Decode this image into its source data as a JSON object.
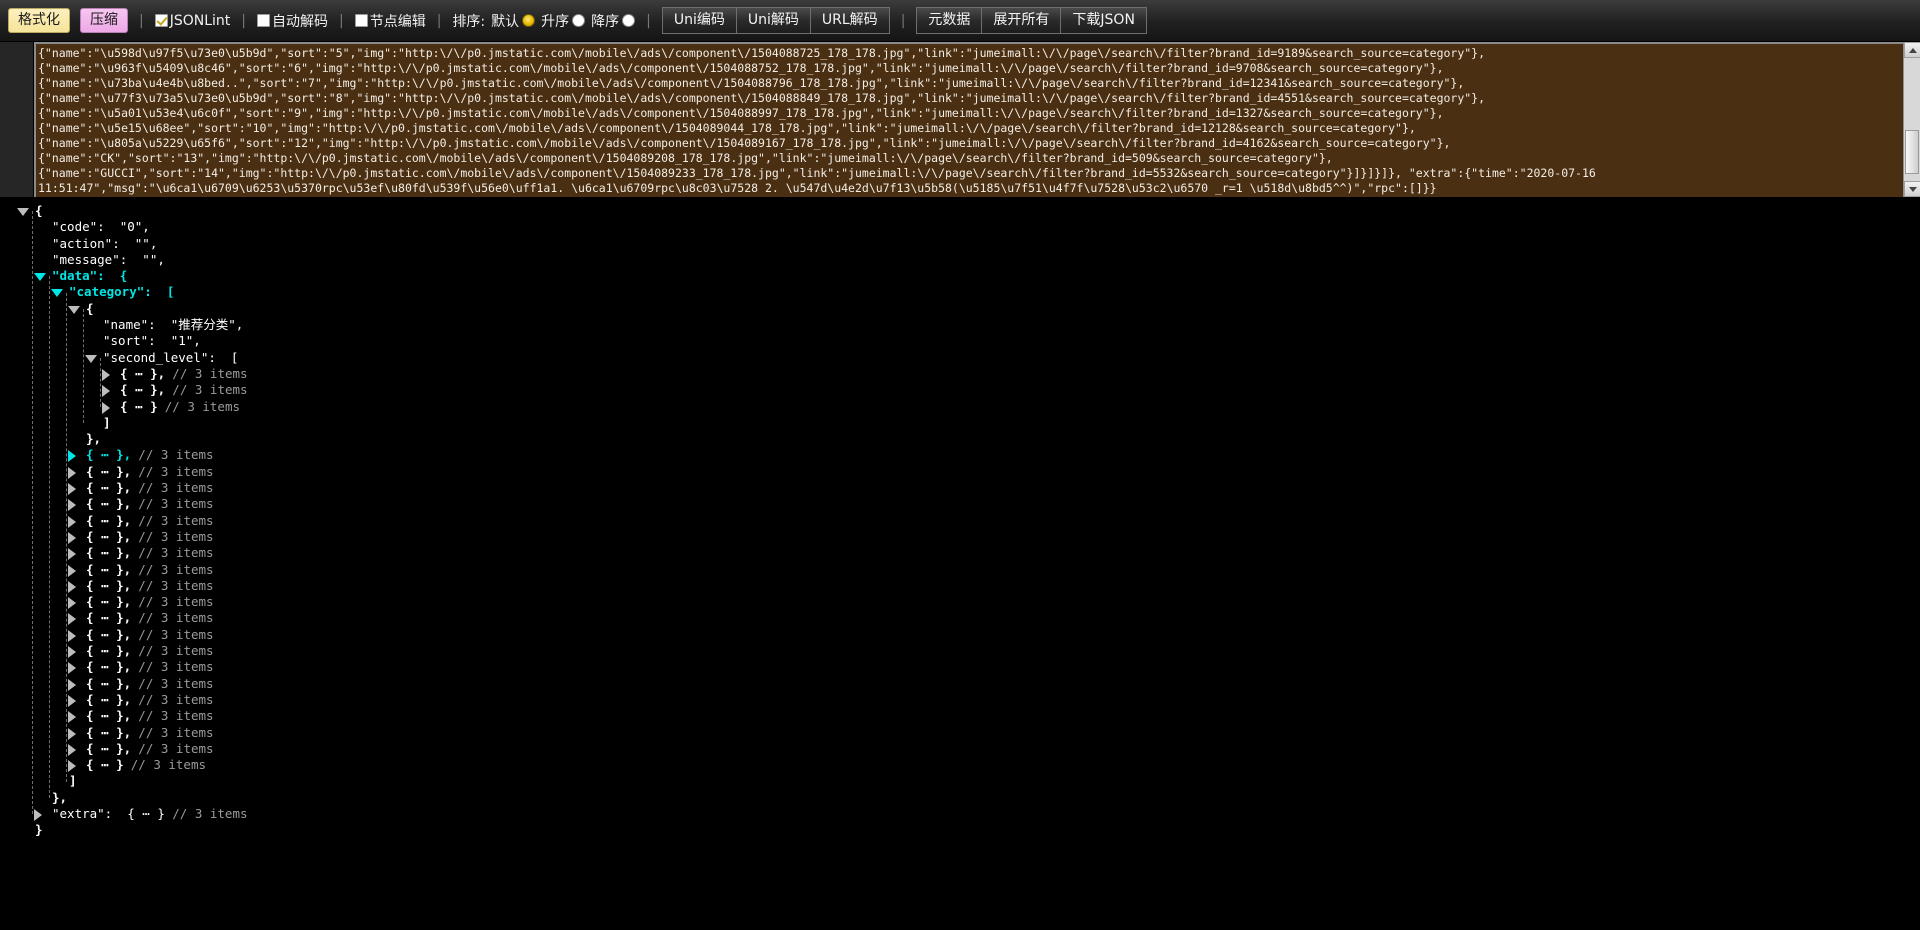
{
  "toolbar": {
    "format_button": "格式化",
    "compress_button": "压缩",
    "separator": "|",
    "jsonlint_label": "JSONLint",
    "jsonlint_checked": true,
    "autodecode_label": "自动解码",
    "autodecode_checked": false,
    "nodeedit_label": "节点编辑",
    "nodeedit_checked": false,
    "sort_label": "排序:",
    "sort_default": "默认",
    "sort_asc": "升序",
    "sort_desc": "降序",
    "sort_selected": "默认",
    "uni_encode": "Uni编码",
    "uni_decode": "Uni解码",
    "url_decode": "URL解码",
    "metadata": "元数据",
    "expand_all": "展开所有",
    "download_json": "下载JSON",
    "accent_yellow": "#f6e49a",
    "accent_pink": "#eda9e6",
    "radio_selected_color": "#e8b800"
  },
  "raw_editor": {
    "background": "#4a2f13",
    "text_color": "#f3ede4",
    "lines": [
      "{\"name\":\"\\u598d\\u97f5\\u73e0\\u5b9d\",\"sort\":\"5\",\"img\":\"http:\\/\\/p0.jmstatic.com\\/mobile\\/ads\\/component\\/1504088725_178_178.jpg\",\"link\":\"jumeimall:\\/\\/page\\/search\\/filter?brand_id=9189&search_source=category\"},",
      "{\"name\":\"\\u963f\\u5409\\u8c46\",\"sort\":\"6\",\"img\":\"http:\\/\\/p0.jmstatic.com\\/mobile\\/ads\\/component\\/1504088752_178_178.jpg\",\"link\":\"jumeimall:\\/\\/page\\/search\\/filter?brand_id=9708&search_source=category\"},",
      "{\"name\":\"\\u73ba\\u4e4b\\u8bed..\",\"sort\":\"7\",\"img\":\"http:\\/\\/p0.jmstatic.com\\/mobile\\/ads\\/component\\/1504088796_178_178.jpg\",\"link\":\"jumeimall:\\/\\/page\\/search\\/filter?brand_id=12341&search_source=category\"},",
      "{\"name\":\"\\u77f3\\u73a5\\u73e0\\u5b9d\",\"sort\":\"8\",\"img\":\"http:\\/\\/p0.jmstatic.com\\/mobile\\/ads\\/component\\/1504088849_178_178.jpg\",\"link\":\"jumeimall:\\/\\/page\\/search\\/filter?brand_id=4551&search_source=category\"},",
      "{\"name\":\"\\u5a01\\u53e4\\u6c0f\",\"sort\":\"9\",\"img\":\"http:\\/\\/p0.jmstatic.com\\/mobile\\/ads\\/component\\/1504088997_178_178.jpg\",\"link\":\"jumeimall:\\/\\/page\\/search\\/filter?brand_id=1327&search_source=category\"},",
      "{\"name\":\"\\u5e15\\u68ee\",\"sort\":\"10\",\"img\":\"http:\\/\\/p0.jmstatic.com\\/mobile\\/ads\\/component\\/1504089044_178_178.jpg\",\"link\":\"jumeimall:\\/\\/page\\/search\\/filter?brand_id=12128&search_source=category\"},",
      "{\"name\":\"\\u805a\\u5229\\u65f6\",\"sort\":\"12\",\"img\":\"http:\\/\\/p0.jmstatic.com\\/mobile\\/ads\\/component\\/1504089167_178_178.jpg\",\"link\":\"jumeimall:\\/\\/page\\/search\\/filter?brand_id=4162&search_source=category\"},",
      "{\"name\":\"CK\",\"sort\":\"13\",\"img\":\"http:\\/\\/p0.jmstatic.com\\/mobile\\/ads\\/component\\/1504089208_178_178.jpg\",\"link\":\"jumeimall:\\/\\/page\\/search\\/filter?brand_id=509&search_source=category\"},",
      "{\"name\":\"GUCCI\",\"sort\":\"14\",\"img\":\"http:\\/\\/p0.jmstatic.com\\/mobile\\/ads\\/component\\/1504089233_178_178.jpg\",\"link\":\"jumeimall:\\/\\/page\\/search\\/filter?brand_id=5532&search_source=category\"}]}]}]}, \"extra\":{\"time\":\"2020-07-16",
      "11:51:47\",\"msg\":\"\\u6ca1\\u6709\\u6253\\u5370rpc\\u53ef\\u80fd\\u539f\\u56e0\\uff1a1. \\u6ca1\\u6709rpc\\u8c03\\u7528 2. \\u547d\\u4e2d\\u7f13\\u5b58(\\u5185\\u7f51\\u4f7f\\u7528\\u53c2\\u6570 _r=1 \\u518d\\u8bd5^^)\",\"rpc\":[]}}"
    ]
  },
  "tree": {
    "rows": [
      {
        "indent": 0,
        "marker": "down-grey",
        "text": "{",
        "style": "ph"
      },
      {
        "indent": 1,
        "marker": "",
        "text": "\"code\":  \"0\",",
        "style": "plain"
      },
      {
        "indent": 1,
        "marker": "",
        "text": "\"action\":  \"\",",
        "style": "plain"
      },
      {
        "indent": 1,
        "marker": "",
        "text": "\"message\":  \"\",",
        "style": "plain"
      },
      {
        "indent": 1,
        "marker": "down-cyan",
        "text": "\"data\":  {",
        "style": "cyan"
      },
      {
        "indent": 2,
        "marker": "down-cyan",
        "text": "\"category\":  [",
        "style": "cyan"
      },
      {
        "indent": 3,
        "marker": "down-grey",
        "text": "{",
        "style": "ph"
      },
      {
        "indent": 4,
        "marker": "",
        "text": "\"name\":  \"推荐分类\",",
        "style": "plain"
      },
      {
        "indent": 4,
        "marker": "",
        "text": "\"sort\":  \"1\",",
        "style": "plain"
      },
      {
        "indent": 4,
        "marker": "down-grey",
        "text": "\"second_level\":  [",
        "style": "plain"
      },
      {
        "indent": 5,
        "marker": "right-grey",
        "text": "{ ⋯ },",
        "comment": "// 3 items",
        "style": "ph"
      },
      {
        "indent": 5,
        "marker": "right-grey",
        "text": "{ ⋯ },",
        "comment": "// 3 items",
        "style": "ph"
      },
      {
        "indent": 5,
        "marker": "right-grey",
        "text": "{ ⋯ }",
        "comment": "// 3 items",
        "style": "ph"
      },
      {
        "indent": 4,
        "marker": "",
        "text": "]",
        "style": "ph"
      },
      {
        "indent": 3,
        "marker": "",
        "text": "},",
        "style": "ph"
      },
      {
        "indent": 3,
        "marker": "right-cyan",
        "text": "{ ⋯ },",
        "comment": "// 3 items",
        "style": "ph-cyan"
      },
      {
        "indent": 3,
        "marker": "right-grey",
        "text": "{ ⋯ },",
        "comment": "// 3 items",
        "style": "ph"
      },
      {
        "indent": 3,
        "marker": "right-grey",
        "text": "{ ⋯ },",
        "comment": "// 3 items",
        "style": "ph"
      },
      {
        "indent": 3,
        "marker": "right-grey",
        "text": "{ ⋯ },",
        "comment": "// 3 items",
        "style": "ph"
      },
      {
        "indent": 3,
        "marker": "right-grey",
        "text": "{ ⋯ },",
        "comment": "// 3 items",
        "style": "ph"
      },
      {
        "indent": 3,
        "marker": "right-grey",
        "text": "{ ⋯ },",
        "comment": "// 3 items",
        "style": "ph"
      },
      {
        "indent": 3,
        "marker": "right-grey",
        "text": "{ ⋯ },",
        "comment": "// 3 items",
        "style": "ph"
      },
      {
        "indent": 3,
        "marker": "right-grey",
        "text": "{ ⋯ },",
        "comment": "// 3 items",
        "style": "ph"
      },
      {
        "indent": 3,
        "marker": "right-grey",
        "text": "{ ⋯ },",
        "comment": "// 3 items",
        "style": "ph"
      },
      {
        "indent": 3,
        "marker": "right-grey",
        "text": "{ ⋯ },",
        "comment": "// 3 items",
        "style": "ph"
      },
      {
        "indent": 3,
        "marker": "right-grey",
        "text": "{ ⋯ },",
        "comment": "// 3 items",
        "style": "ph"
      },
      {
        "indent": 3,
        "marker": "right-grey",
        "text": "{ ⋯ },",
        "comment": "// 3 items",
        "style": "ph"
      },
      {
        "indent": 3,
        "marker": "right-grey",
        "text": "{ ⋯ },",
        "comment": "// 3 items",
        "style": "ph"
      },
      {
        "indent": 3,
        "marker": "right-grey",
        "text": "{ ⋯ },",
        "comment": "// 3 items",
        "style": "ph"
      },
      {
        "indent": 3,
        "marker": "right-grey",
        "text": "{ ⋯ },",
        "comment": "// 3 items",
        "style": "ph"
      },
      {
        "indent": 3,
        "marker": "right-grey",
        "text": "{ ⋯ },",
        "comment": "// 3 items",
        "style": "ph"
      },
      {
        "indent": 3,
        "marker": "right-grey",
        "text": "{ ⋯ },",
        "comment": "// 3 items",
        "style": "ph"
      },
      {
        "indent": 3,
        "marker": "right-grey",
        "text": "{ ⋯ },",
        "comment": "// 3 items",
        "style": "ph"
      },
      {
        "indent": 3,
        "marker": "right-grey",
        "text": "{ ⋯ },",
        "comment": "// 3 items",
        "style": "ph"
      },
      {
        "indent": 3,
        "marker": "right-grey",
        "text": "{ ⋯ }",
        "comment": "// 3 items",
        "style": "ph"
      },
      {
        "indent": 2,
        "marker": "",
        "text": "]",
        "style": "ph"
      },
      {
        "indent": 1,
        "marker": "",
        "text": "},",
        "style": "ph"
      },
      {
        "indent": 1,
        "marker": "right-grey",
        "text": "\"extra\":  { ⋯ }",
        "comment": "// 3 items",
        "style": "plain"
      },
      {
        "indent": 0,
        "marker": "",
        "text": "}",
        "style": "ph"
      }
    ]
  }
}
